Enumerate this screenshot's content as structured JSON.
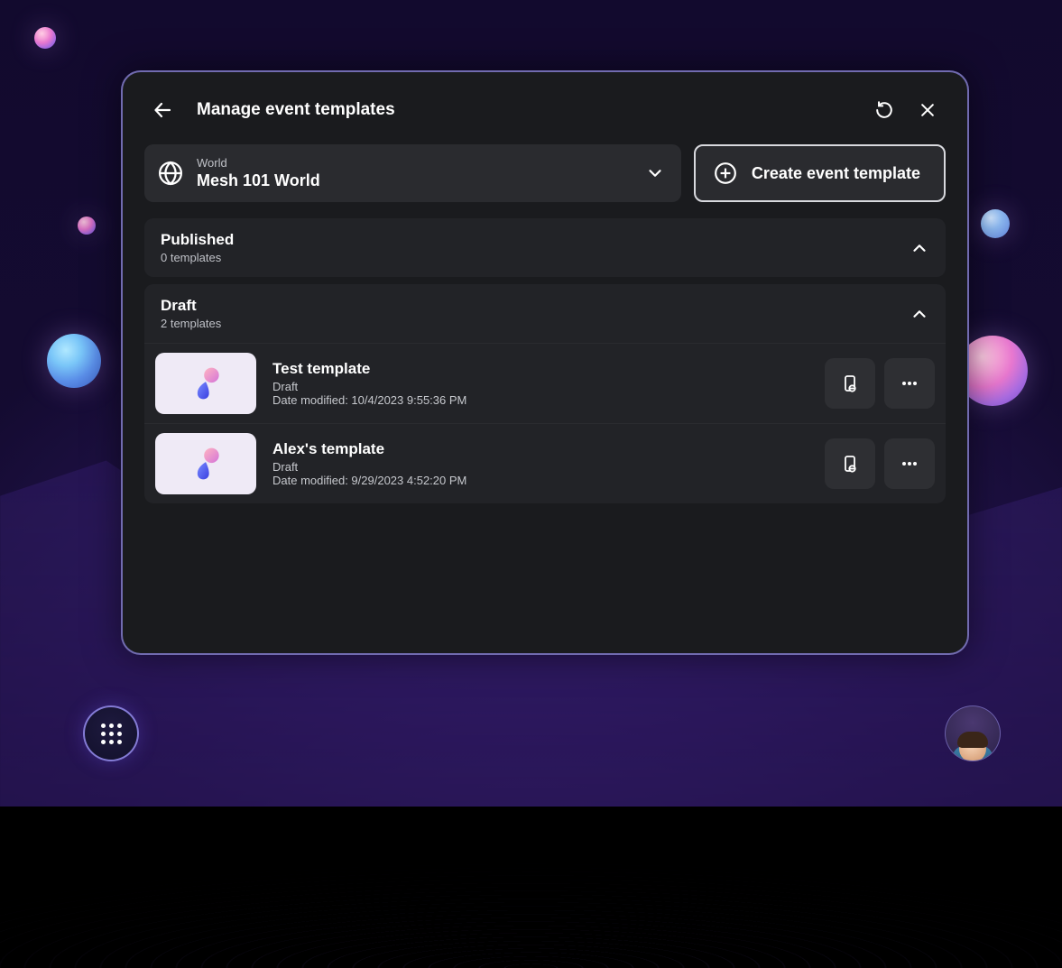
{
  "header": {
    "title": "Manage event templates"
  },
  "world_selector": {
    "label": "World",
    "value": "Mesh 101 World"
  },
  "create_button": {
    "label": "Create event template"
  },
  "sections": {
    "published": {
      "title": "Published",
      "subtitle": "0 templates"
    },
    "draft": {
      "title": "Draft",
      "subtitle": "2 templates",
      "items": [
        {
          "title": "Test template",
          "status": "Draft",
          "date_modified": "Date modified: 10/4/2023 9:55:36 PM"
        },
        {
          "title": "Alex's template",
          "status": "Draft",
          "date_modified": "Date modified: 9/29/2023 4:52:20 PM"
        }
      ]
    }
  }
}
